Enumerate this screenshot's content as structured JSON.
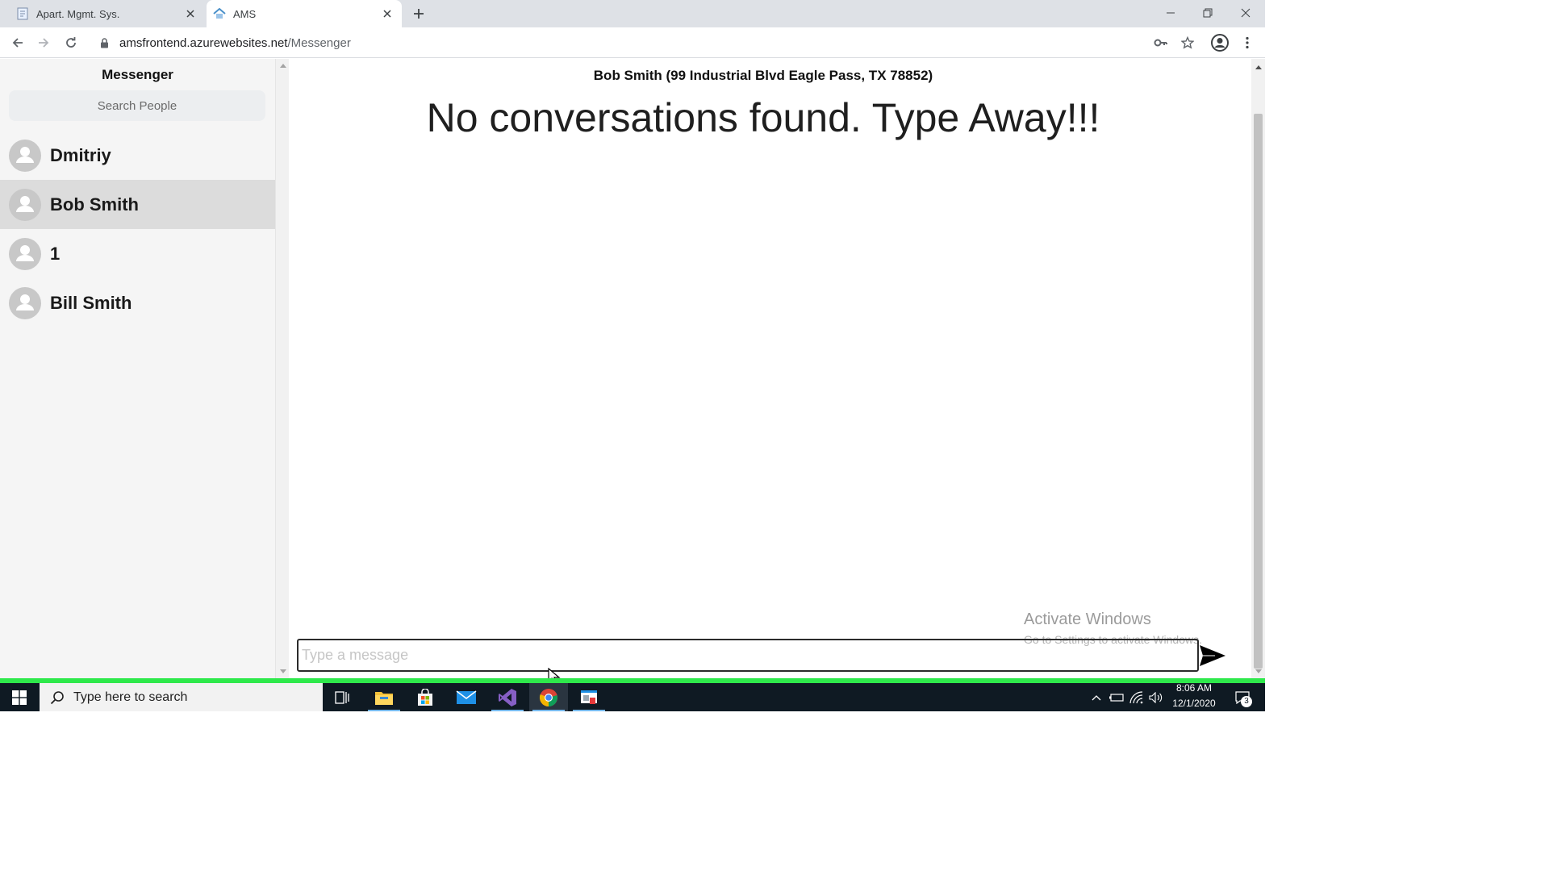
{
  "browser": {
    "tabs": [
      {
        "title": "Apart. Mgmt. Sys.",
        "active": false
      },
      {
        "title": "AMS",
        "active": true
      }
    ],
    "url_host": "amsfrontend.azurewebsites.net",
    "url_path": "/Messenger"
  },
  "sidebar": {
    "title": "Messenger",
    "search_placeholder": "Search People",
    "contacts": [
      {
        "name": "Dmitriy",
        "selected": false
      },
      {
        "name": "Bob Smith",
        "selected": true
      },
      {
        "name": "1",
        "selected": false
      },
      {
        "name": "Bill Smith",
        "selected": false
      }
    ]
  },
  "chat": {
    "header": "Bob Smith (99 Industrial Blvd Eagle Pass, TX 78852)",
    "empty_message": "No conversations found. Type Away!!!",
    "input_placeholder": "Type a message"
  },
  "watermark": {
    "line1": "Activate Windows",
    "line2": "Go to Settings to activate Windows."
  },
  "taskbar": {
    "search_placeholder": "Type here to search",
    "time": "8:06 AM",
    "date": "12/1/2020",
    "notification_count": "3"
  },
  "colors": {
    "selected_contact": "#dcdcdc",
    "sidebar_bg": "#f5f5f5",
    "taskbar_bg": "#0f1a23",
    "accent_line": "#2ee94b"
  }
}
